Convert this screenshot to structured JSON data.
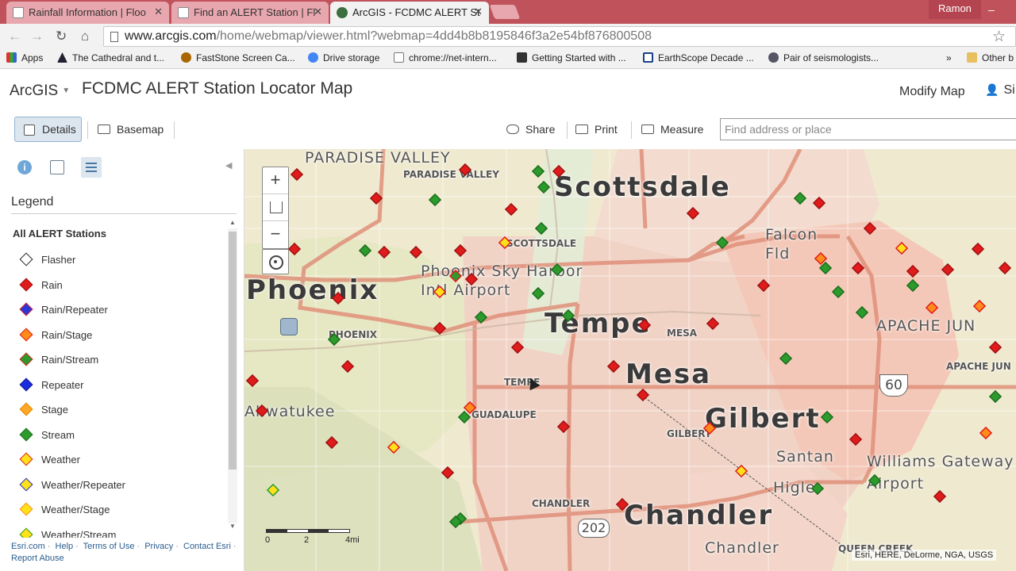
{
  "browser": {
    "tabs": [
      {
        "title": "Rainfall Information | Floo"
      },
      {
        "title": "Find an ALERT Station | Fl"
      },
      {
        "title": "ArcGIS - FCDMC ALERT St"
      }
    ],
    "profile": "Ramon",
    "url_host": "www.arcgis.com",
    "url_path": "/home/webmap/viewer.html?webmap=4dd4b8b8195846f3a2e54bf876800508",
    "bookmarks": [
      "Apps",
      "The Cathedral and t...",
      "FastStone Screen Ca...",
      "Drive storage",
      "chrome://net-intern...",
      "Getting Started with ...",
      "EarthScope Decade ...",
      "Pair of seismologists..."
    ],
    "more_bookmarks": "»",
    "other_bookmarks": "Other b"
  },
  "header": {
    "brand": "ArcGIS",
    "title": "FCDMC ALERT Station Locator Map",
    "modify": "Modify Map",
    "signin": "Si"
  },
  "toolbar": {
    "details": "Details",
    "basemap": "Basemap",
    "share": "Share",
    "print": "Print",
    "measure": "Measure",
    "search_placeholder": "Find address or place"
  },
  "legend": {
    "title": "Legend",
    "layer": "All ALERT Stations",
    "items": [
      {
        "label": "Flasher",
        "fill": "#ffffff",
        "stroke": "#222222"
      },
      {
        "label": "Rain",
        "fill": "#e01b1b",
        "stroke": "#a01010"
      },
      {
        "label": "Rain/Repeater",
        "fill": "#2a36d6",
        "stroke": "#e01b1b"
      },
      {
        "label": "Rain/Stage",
        "fill": "#ff8c1a",
        "stroke": "#e01b1b"
      },
      {
        "label": "Rain/Stream",
        "fill": "#2c9a2c",
        "stroke": "#e01b1b"
      },
      {
        "label": "Repeater",
        "fill": "#1a2be0",
        "stroke": "#10208a"
      },
      {
        "label": "Stage",
        "fill": "#ffa726",
        "stroke": "#e08a00"
      },
      {
        "label": "Stream",
        "fill": "#2c9a2c",
        "stroke": "#1c6e1c"
      },
      {
        "label": "Weather",
        "fill": "#ffe11a",
        "stroke": "#e01b1b"
      },
      {
        "label": "Weather/Repeater",
        "fill": "#ffe11a",
        "stroke": "#1a2be0"
      },
      {
        "label": "Weather/Stage",
        "fill": "#ffe11a",
        "stroke": "#ff8c1a"
      },
      {
        "label": "Weather/Stream",
        "fill": "#ffe11a",
        "stroke": "#2c9a2c"
      }
    ]
  },
  "footer": {
    "links": [
      "Esri.com",
      "Help",
      "Terms of Use",
      "Privacy",
      "Contact Esri",
      "Report Abuse"
    ]
  },
  "map": {
    "labels": {
      "scottsdale": "Scottsdale",
      "phoenix": "Phoenix",
      "tempe": "Tempe",
      "mesa": "Mesa",
      "gilbert": "Gilbert",
      "chandler": "Chandler",
      "paradise_valley": "PARADISE VALLEY",
      "paradise_valley_small": "PARADISE VALLEY",
      "scottsdale_small": "SCOTTSDALE",
      "sky_harbor": "Phoenix Sky Harbor Intl Airport",
      "phoenix_small": "PHOENIX",
      "tempe_small": "TEMPE",
      "mesa_small": "MESA",
      "gilbert_small": "GILBERT",
      "chandler_small": "CHANDLER",
      "guadalupe": "GUADALUPE",
      "falcon": "Falcon Fld",
      "apache": "APACHE JUN",
      "apache_small": "APACHE JUN",
      "santan": "Santan",
      "williams": "Williams Gateway Airport",
      "higley": "Higle",
      "chandler2": "Chandler",
      "queen_creek": "QUEEN CREEK",
      "ahwatukee": "Ahwatukee",
      "route60": "60",
      "route202": "202"
    },
    "scale": {
      "zero": "0",
      "two": "2",
      "four": "4mi"
    },
    "attribution": "Esri, HERE, DeLorme, NGA, USGS"
  }
}
